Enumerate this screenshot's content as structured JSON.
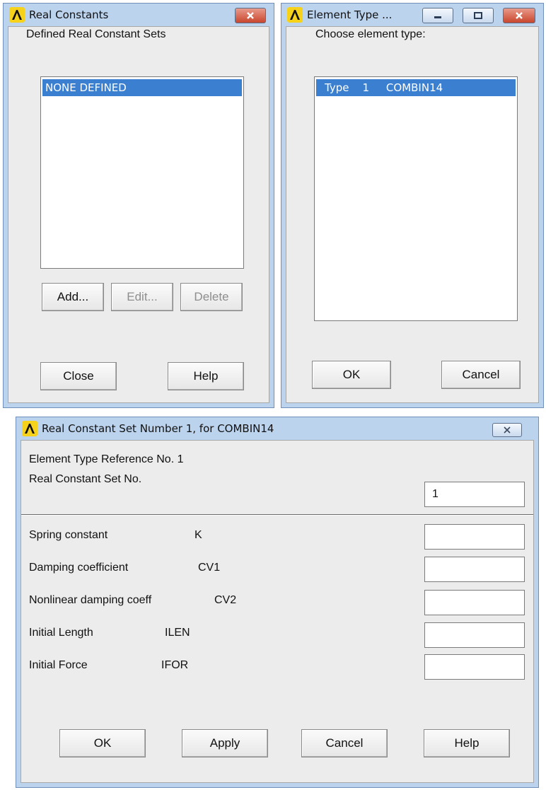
{
  "real_constants_dialog": {
    "title": "Real Constants",
    "list_label": "Defined Real Constant Sets",
    "list_items": [
      "NONE DEFINED"
    ],
    "buttons": {
      "add": "Add...",
      "edit": "Edit...",
      "delete": "Delete",
      "close": "Close",
      "help": "Help"
    }
  },
  "element_type_dialog": {
    "title": "Element Type ...",
    "list_label": "Choose element type:",
    "list_items": [
      "Type    1     COMBIN14"
    ],
    "buttons": {
      "ok": "OK",
      "cancel": "Cancel"
    }
  },
  "real_constant_set_dialog": {
    "title": "Real Constant Set Number 1, for COMBIN14",
    "element_type_ref": "Element Type Reference No. 1",
    "set_no_label": "Real Constant Set No.",
    "set_no_value": "1",
    "fields": [
      {
        "label": "Spring constant",
        "code": "K",
        "value": ""
      },
      {
        "label": "Damping coefficient",
        "code": "CV1",
        "value": ""
      },
      {
        "label": "Nonlinear damping coeff",
        "code": "CV2",
        "value": ""
      },
      {
        "label": "Initial Length",
        "code": "ILEN",
        "value": ""
      },
      {
        "label": "Initial Force",
        "code": "IFOR",
        "value": ""
      }
    ],
    "buttons": {
      "ok": "OK",
      "apply": "Apply",
      "cancel": "Cancel",
      "help": "Help"
    }
  },
  "icons": {
    "app_logo": "ansys-logo-icon",
    "close": "close-icon",
    "minimize": "minimize-icon",
    "restore": "restore-icon"
  },
  "colors": {
    "window_frame": "#bcd3ee",
    "selection": "#3b7fd0",
    "close_button": "#c9462d",
    "logo": "#f7d21a"
  }
}
